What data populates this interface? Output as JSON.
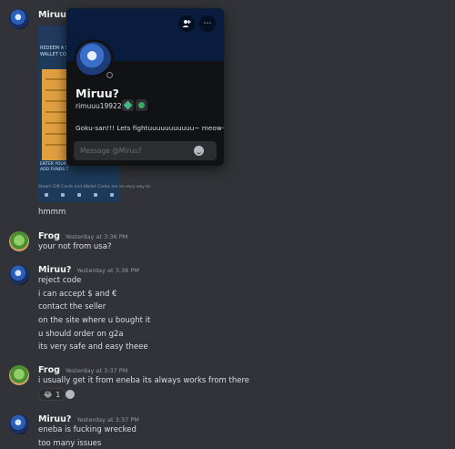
{
  "messages": [
    {
      "author": "Miruu?",
      "timestamp": "",
      "lines": [
        "hmmm"
      ],
      "attachment": {
        "redeem_text": "REDEEM A S\nWALLET CO",
        "enter_text": "ENTER YOUR\nADD FUNDS T",
        "caption": "Steam Gift Cards and Wallet Codes are an easy way to"
      }
    },
    {
      "author": "Frog",
      "timestamp": "Yesterday at 3:36 PM",
      "lines": [
        "your not from usa?"
      ]
    },
    {
      "author": "Miruu?",
      "timestamp": "Yesterday at 3:36 PM",
      "lines": [
        "reject code",
        "i can accept $ and €",
        "contact the seller",
        "on the site where u bought it",
        "u should order on g2a",
        "its very safe and easy theee"
      ]
    },
    {
      "author": "Frog",
      "timestamp": "Yesterday at 3:37 PM",
      "lines": [
        "i usually get it from eneba its always works from there"
      ],
      "reaction": {
        "emoji": "😂",
        "count": "1"
      }
    },
    {
      "author": "Miruu?",
      "timestamp": "Yesterday at 3:37 PM",
      "lines": [
        "eneba is fucking wrecked",
        "too many issues"
      ]
    }
  ],
  "profile": {
    "display_name": "Miruu?",
    "username": "rimuuu19922",
    "bio": "Goku-san!!! Lets fightuuuuuuuuuuu~ meow~",
    "message_placeholder": "Message @Miruu?",
    "banner_color": "#0a1c3e",
    "buttons": [
      "add-friend-icon",
      "more-icon"
    ]
  },
  "colors": {
    "background": "#313338",
    "card": "#111214",
    "input": "#2b2d31"
  }
}
